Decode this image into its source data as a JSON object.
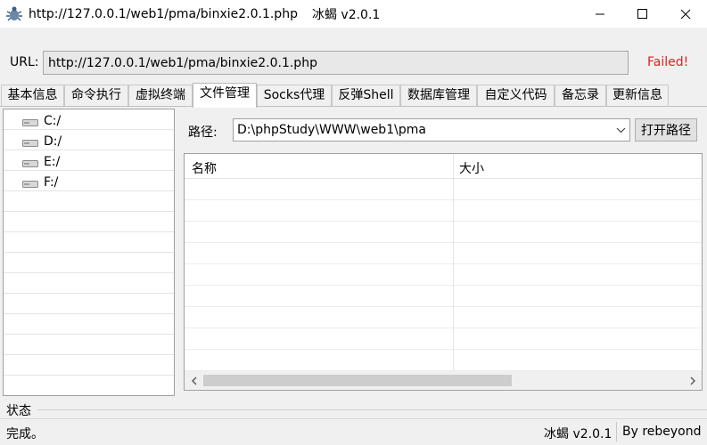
{
  "window": {
    "title_url": "http://127.0.0.1/web1/pma/binxie2.0.1.php",
    "title_app": "冰蝎 v2.0.1"
  },
  "url_bar": {
    "label": "URL:",
    "value": "http://127.0.0.1/web1/pma/binxie2.0.1.php",
    "status": "Failed!",
    "status_color": "#e02020"
  },
  "tabs": [
    {
      "label": "基本信息"
    },
    {
      "label": "命令执行"
    },
    {
      "label": "虚拟终端"
    },
    {
      "label": "文件管理",
      "active": true
    },
    {
      "label": "Socks代理"
    },
    {
      "label": "反弹Shell"
    },
    {
      "label": "数据库管理"
    },
    {
      "label": "自定义代码"
    },
    {
      "label": "备忘录"
    },
    {
      "label": "更新信息"
    }
  ],
  "drives": [
    {
      "label": "C:/"
    },
    {
      "label": "D:/"
    },
    {
      "label": "E:/"
    },
    {
      "label": "F:/"
    }
  ],
  "path": {
    "label": "路径:",
    "value": "D:\\phpStudy\\WWW\\web1\\pma",
    "open_button": "打开路径"
  },
  "file_table": {
    "columns": [
      "名称",
      "大小"
    ]
  },
  "status": {
    "group_label": "状态",
    "text": "完成。",
    "version": "冰蝎 v2.0.1",
    "author": "By rebeyond"
  },
  "icons": {
    "app": "scorpion-icon",
    "drive": "hard-drive-icon",
    "minimize": "minimize-icon",
    "maximize": "maximize-icon",
    "close": "close-icon",
    "dropdown": "chevron-down-icon"
  }
}
